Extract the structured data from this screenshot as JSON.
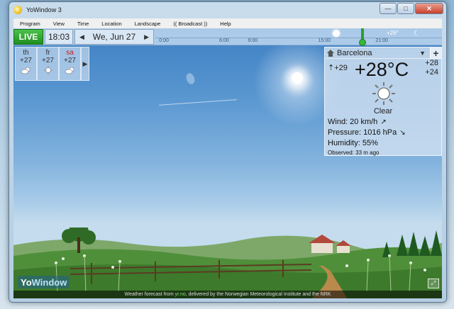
{
  "window": {
    "title": "YoWindow 3",
    "controls": {
      "minimize": "—",
      "maximize": "□",
      "close": "✕"
    }
  },
  "menu": [
    "Program",
    "View",
    "Time",
    "Location",
    "Landscape",
    "(( Broadcast ))",
    "Help"
  ],
  "topbar": {
    "live_label": "LIVE",
    "time": "18:03",
    "date": "We, Jun 27",
    "prev_arrow": "◀",
    "next_arrow": "▶",
    "timeline_ticks": [
      {
        "label": "0:00",
        "pos": 0.03
      },
      {
        "label": "6:00",
        "pos": 0.24
      },
      {
        "label": "9:00",
        "pos": 0.34
      },
      {
        "label": "15:00",
        "pos": 0.59
      },
      {
        "label": "21:00",
        "pos": 0.79
      }
    ],
    "timeline_temp": "+26°"
  },
  "forecast": {
    "days": [
      {
        "name": "th",
        "temp": "+27",
        "icon": "partly-cloudy-icon",
        "weekend": false
      },
      {
        "name": "fr",
        "temp": "+27",
        "icon": "sun-icon",
        "weekend": false
      },
      {
        "name": "sa",
        "temp": "+27",
        "icon": "partly-cloudy-icon",
        "weekend": true
      }
    ],
    "next_label": "▶"
  },
  "weather": {
    "city": "Barcelona",
    "dropdown": "▼",
    "add_label": "+",
    "feels_like": "+29",
    "temperature": "+28°C",
    "high": "+28",
    "low": "+24",
    "description": "Clear",
    "wind": "Wind:  20 km/h",
    "pressure": "Pressure:  1016 hPa",
    "humidity": "Humidity:  55%",
    "observed": "Observed:  33 m ago"
  },
  "footer": {
    "prefix": "Weather forecast from ",
    "link": "yr.no",
    "suffix": ", delivered by the Norwegian Meteorological Institute and the NRK"
  },
  "logo": {
    "yo": "Yo",
    "window": "Window"
  }
}
